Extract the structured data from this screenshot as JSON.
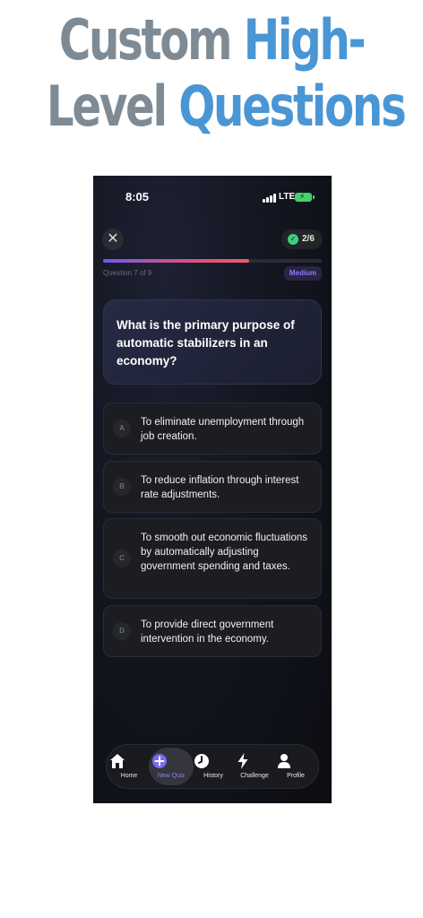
{
  "headline": {
    "line1_part1": "Custom ",
    "line1_part2": "High-",
    "line2_part1": "Level ",
    "line2_part2": "Questions"
  },
  "status_bar": {
    "time": "8:05",
    "network": "LTE"
  },
  "quiz": {
    "close_icon": "close-icon",
    "score": "2/6",
    "progress": 0.67,
    "question_counter": "Question 7 of 9",
    "difficulty": "Medium",
    "question": "What is the primary purpose of automatic stabilizers in an economy?",
    "options": [
      {
        "letter": "A",
        "text": "To eliminate unemployment through job creation."
      },
      {
        "letter": "B",
        "text": "To reduce inflation through interest rate adjustments."
      },
      {
        "letter": "C",
        "text": "To smooth out economic fluctuations by automatically adjusting government spending and taxes."
      },
      {
        "letter": "D",
        "text": "To provide direct government intervention in the economy."
      }
    ]
  },
  "nav": {
    "items": [
      {
        "label": "Home",
        "icon": "home-icon"
      },
      {
        "label": "New Quiz",
        "icon": "plus-circle-icon"
      },
      {
        "label": "History",
        "icon": "clock-icon"
      },
      {
        "label": "Challenge",
        "icon": "lightning-icon"
      },
      {
        "label": "Profile",
        "icon": "person-icon"
      }
    ],
    "active_index": 1
  },
  "colors": {
    "accent": "#6b5cf5",
    "headline_gray": "#7e8b95",
    "headline_blue": "#4a96d4",
    "success": "#3fcf7a"
  }
}
